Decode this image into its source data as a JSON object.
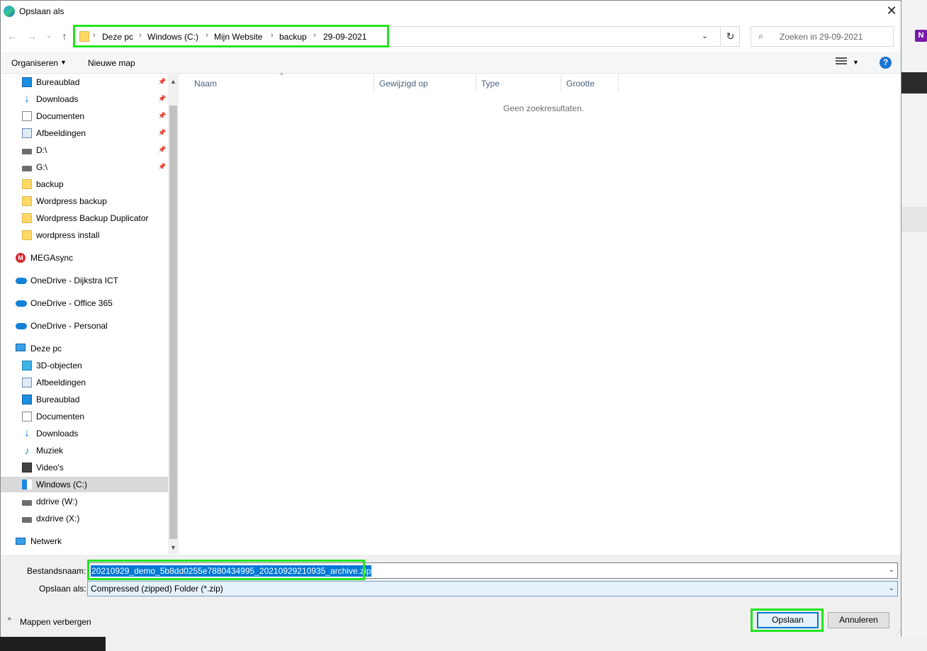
{
  "dialog": {
    "title": "Opslaan als",
    "close_glyph": "✕"
  },
  "nav": {
    "back_glyph": "←",
    "forward_glyph": "→",
    "recent_glyph": "⌄",
    "up_glyph": "↑"
  },
  "address": {
    "crumbs": [
      "Deze pc",
      "Windows (C:)",
      "Mijn Website",
      "backup",
      "29-09-2021"
    ],
    "separator": "›",
    "dropdown_glyph": "⌄",
    "refresh_glyph": "↻"
  },
  "search": {
    "placeholder": "Zoeken in 29-09-2021",
    "icon": "search-icon"
  },
  "toolbar": {
    "organize_label": "Organiseren",
    "new_folder_label": "Nieuwe map",
    "help_label": "?"
  },
  "sidebar": {
    "items": [
      {
        "label": "Bureaublad",
        "icon": "desktop-icon",
        "pinned": true
      },
      {
        "label": "Downloads",
        "icon": "download-icon",
        "pinned": true
      },
      {
        "label": "Documenten",
        "icon": "document-icon",
        "pinned": true
      },
      {
        "label": "Afbeeldingen",
        "icon": "pictures-icon",
        "pinned": true
      },
      {
        "label": "D:\\",
        "icon": "drive-icon",
        "pinned": true
      },
      {
        "label": "G:\\",
        "icon": "drive-icon",
        "pinned": true
      },
      {
        "label": "backup",
        "icon": "folder-icon"
      },
      {
        "label": "Wordpress backup",
        "icon": "folder-icon"
      },
      {
        "label": "Wordpress Backup Duplicator",
        "icon": "folder-icon"
      },
      {
        "label": "wordpress install",
        "icon": "folder-icon"
      },
      {
        "label": "MEGAsync",
        "icon": "mega-icon"
      },
      {
        "label": "OneDrive - Dijkstra ICT",
        "icon": "onedrive-icon"
      },
      {
        "label": "OneDrive - Office 365",
        "icon": "onedrive-icon"
      },
      {
        "label": "OneDrive - Personal",
        "icon": "onedrive-icon"
      },
      {
        "label": "Deze pc",
        "icon": "computer-icon"
      },
      {
        "label": "3D-objecten",
        "icon": "3d-objects-icon"
      },
      {
        "label": "Afbeeldingen",
        "icon": "pictures-icon"
      },
      {
        "label": "Bureaublad",
        "icon": "desktop-icon"
      },
      {
        "label": "Documenten",
        "icon": "document-icon"
      },
      {
        "label": "Downloads",
        "icon": "download-icon"
      },
      {
        "label": "Muziek",
        "icon": "music-icon"
      },
      {
        "label": "Video's",
        "icon": "video-icon"
      },
      {
        "label": "Windows (C:)",
        "icon": "windows-drive-icon",
        "selected": true
      },
      {
        "label": "ddrive (W:)",
        "icon": "drive-icon"
      },
      {
        "label": "dxdrive (X:)",
        "icon": "drive-icon"
      },
      {
        "label": "Netwerk",
        "icon": "network-icon"
      }
    ]
  },
  "filelist": {
    "columns": [
      "Naam",
      "Gewijzigd op",
      "Type",
      "Grootte"
    ],
    "empty_message": "Geen zoekresultaten."
  },
  "footer": {
    "filename_label": "Bestandsnaam:",
    "filename_value": "20210929_demo_5b8dd0255e7880434995_20210929210935_archive.zip",
    "savetype_label": "Opslaan als:",
    "savetype_value": "Compressed (zipped) Folder (*.zip)",
    "hide_folders_label": "Mappen verbergen",
    "save_label": "Opslaan",
    "cancel_label": "Annuleren"
  },
  "colors": {
    "highlight": "#22e51f",
    "accent": "#0078d7"
  }
}
